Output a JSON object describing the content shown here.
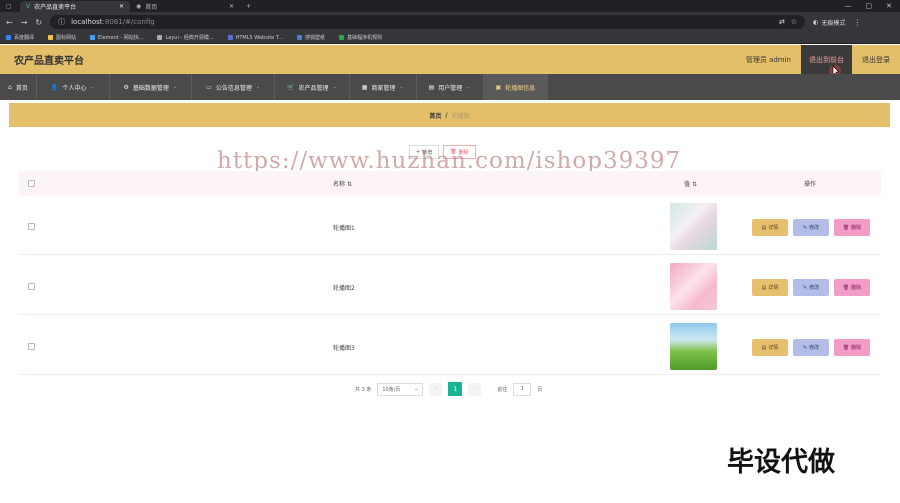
{
  "browser": {
    "tabs": [
      {
        "label": "农产品直卖平台"
      },
      {
        "label": "首页"
      }
    ],
    "url_host": "localhost",
    "url_rest": ":8081/#/config",
    "incognito_label": "无痕模式",
    "bookmarks": [
      "百度翻译",
      "图标网站",
      "Element - 网站快...",
      "Layui - 经典开源模...",
      "HTML5 Website T...",
      "搜狐壁纸",
      "基础程序机规则"
    ]
  },
  "header": {
    "brand": "农产品直卖平台",
    "admin": "管理员 admin",
    "back_label": "退出到前台",
    "logout_label": "退出登录"
  },
  "nav": [
    {
      "label": "首页"
    },
    {
      "label": "个人中心"
    },
    {
      "label": "基础数据管理"
    },
    {
      "label": "公告信息管理"
    },
    {
      "label": "农产品管理"
    },
    {
      "label": "商家管理"
    },
    {
      "label": "用户管理"
    },
    {
      "label": "轮播图信息"
    }
  ],
  "breadcrumb": {
    "home": "首页",
    "sep": "/",
    "current": "轮播图"
  },
  "toolbar": {
    "add_label": "新增",
    "delete_label": "删除"
  },
  "watermark": "https://www.huzhan.com/ishop39397",
  "table": {
    "headers": {
      "name": "名称",
      "value": "值",
      "ops": "操作"
    },
    "rows": [
      {
        "name": "轮播图1"
      },
      {
        "name": "轮播图2"
      },
      {
        "name": "轮播图3"
      }
    ],
    "row_buttons": {
      "detail": "详情",
      "edit": "修改",
      "remove": "删除"
    }
  },
  "pager": {
    "total": "共 3 条",
    "page_size": "10条/页",
    "current": "1",
    "goto_label": "前往",
    "goto_value": "1",
    "page_suffix": "页"
  },
  "corner_text": "毕设代做"
}
